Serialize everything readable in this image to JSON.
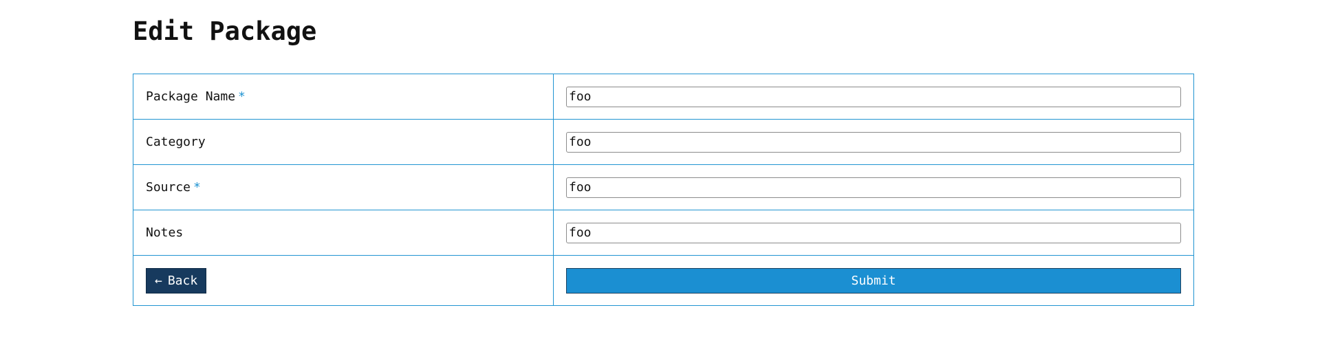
{
  "page": {
    "title": "Edit Package"
  },
  "form": {
    "fields": [
      {
        "label": "Package Name",
        "required_mark": "*",
        "value": "foo"
      },
      {
        "label": "Category",
        "required_mark": "",
        "value": "foo"
      },
      {
        "label": "Source",
        "required_mark": "*",
        "value": "foo"
      },
      {
        "label": "Notes",
        "required_mark": "",
        "value": "foo"
      }
    ],
    "back_arrow": "←",
    "back_label": "Back",
    "submit_label": "Submit"
  },
  "colors": {
    "border": "#1f93d1",
    "required": "#1f93d1",
    "back_button_bg": "#173a5e",
    "submit_button_bg": "#1b8fd2"
  },
  "icons": {
    "back": "arrow-left-icon"
  }
}
